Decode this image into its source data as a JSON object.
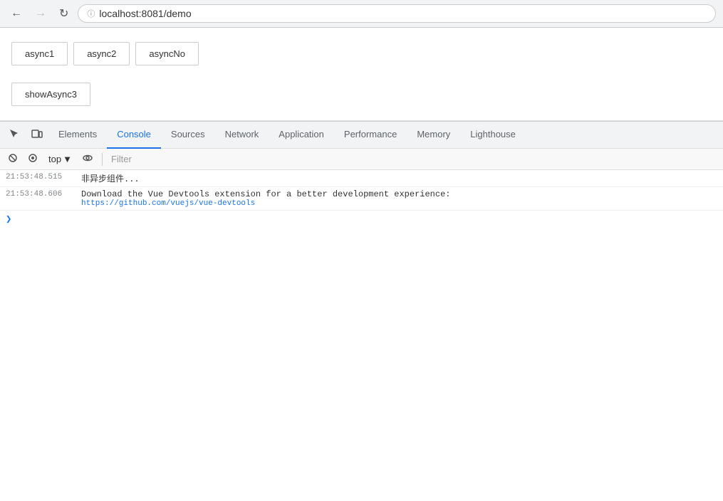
{
  "browser": {
    "url": "localhost:8081/demo",
    "back_btn": "←",
    "forward_btn": "→",
    "reload_btn": "↻"
  },
  "page": {
    "buttons_row1": [
      "async1",
      "async2",
      "asyncNo"
    ],
    "buttons_row2": [
      "showAsync3"
    ]
  },
  "devtools": {
    "tabs": [
      {
        "label": "Elements",
        "active": false
      },
      {
        "label": "Console",
        "active": true
      },
      {
        "label": "Sources",
        "active": false
      },
      {
        "label": "Network",
        "active": false
      },
      {
        "label": "Application",
        "active": false
      },
      {
        "label": "Performance",
        "active": false
      },
      {
        "label": "Memory",
        "active": false
      },
      {
        "label": "Lighthouse",
        "active": false
      }
    ],
    "toolbar": {
      "top_label": "top",
      "filter_placeholder": "Filter"
    },
    "console_lines": [
      {
        "timestamp": "21:53:48.515",
        "text": "非异步组件...",
        "is_info": false
      },
      {
        "timestamp": "21:53:48.606",
        "text": "Download the Vue Devtools extension for a better development experience:",
        "link": "https://github.com/vuejs/vue-devtools",
        "is_info": true
      }
    ]
  }
}
